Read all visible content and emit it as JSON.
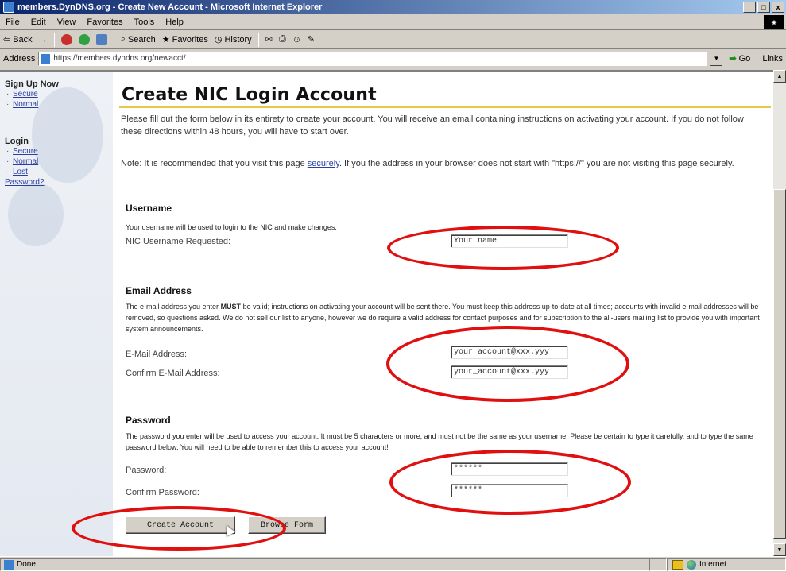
{
  "window": {
    "title": "members.DynDNS.org - Create New Account - Microsoft Internet Explorer",
    "buttons": [
      "_",
      "□",
      "x"
    ]
  },
  "menu": [
    "File",
    "Edit",
    "View",
    "Favorites",
    "Tools",
    "Help"
  ],
  "toolbar": {
    "back": "Back",
    "forward": "→",
    "search": "Search",
    "favorites": "Favorites",
    "history": "History"
  },
  "address": {
    "label": "Address",
    "url": "https://members.dyndns.org/newacct/",
    "go": "Go",
    "links": "Links"
  },
  "sidebar": {
    "signup_heading": "Sign Up Now",
    "signup_links": [
      "Secure",
      "Normal"
    ],
    "login_heading": "Login",
    "login_links": [
      "Secure",
      "Normal",
      "Lost"
    ],
    "lost_password": "Password?"
  },
  "page": {
    "title": "Create NIC Login Account",
    "intro": "Please fill out the form below in its entirety to create your account. You will receive an email containing instructions on activating your account. If you do not follow these directions within 48 hours, you will have to start over.",
    "note_before": "Note: It is recommended that you visit this page ",
    "note_link": "securely",
    "note_after": ". If you the address in your browser does not start with \"https://\" you are not visiting this page securely."
  },
  "username_section": {
    "heading": "Username",
    "description": "Your username will be used to login to the NIC and make changes.",
    "label": "NIC Username Requested:",
    "value": "Your name"
  },
  "email_section": {
    "heading": "Email Address",
    "desc_before": "The e-mail address you enter ",
    "desc_bold": "MUST",
    "desc_after": " be valid; instructions on activating your account will be sent there. You must keep this address up-to-date at all times; accounts with invalid e-mail addresses will be removed, so questions asked. We do not sell our list to anyone, however we do require a valid address for contact purposes and for subscription to the all-users mailing list to provide you with important system announcements.",
    "label": "E-Mail Address:",
    "value": "your_account@xxx.yyy",
    "confirm_label": "Confirm E-Mail Address:",
    "confirm_value": "your_account@xxx.yyy"
  },
  "password_section": {
    "heading": "Password",
    "description": "The password you enter will be used to access your account. It must be 5 characters or more, and must not be the same as your username. Please be certain to type it carefully, and to type the same password below. You will need to be able to remember this to access your account!",
    "label": "Password:",
    "value": "******",
    "confirm_label": "Confirm Password:",
    "confirm_value": "******"
  },
  "buttons": {
    "create": "Create Account",
    "browse": "Browse Form"
  },
  "status": {
    "text": "Done",
    "zone": "Internet"
  },
  "colors": {
    "annotation": "#e01010",
    "title_rule": "#e8c84a",
    "link": "#2b3fa0"
  }
}
